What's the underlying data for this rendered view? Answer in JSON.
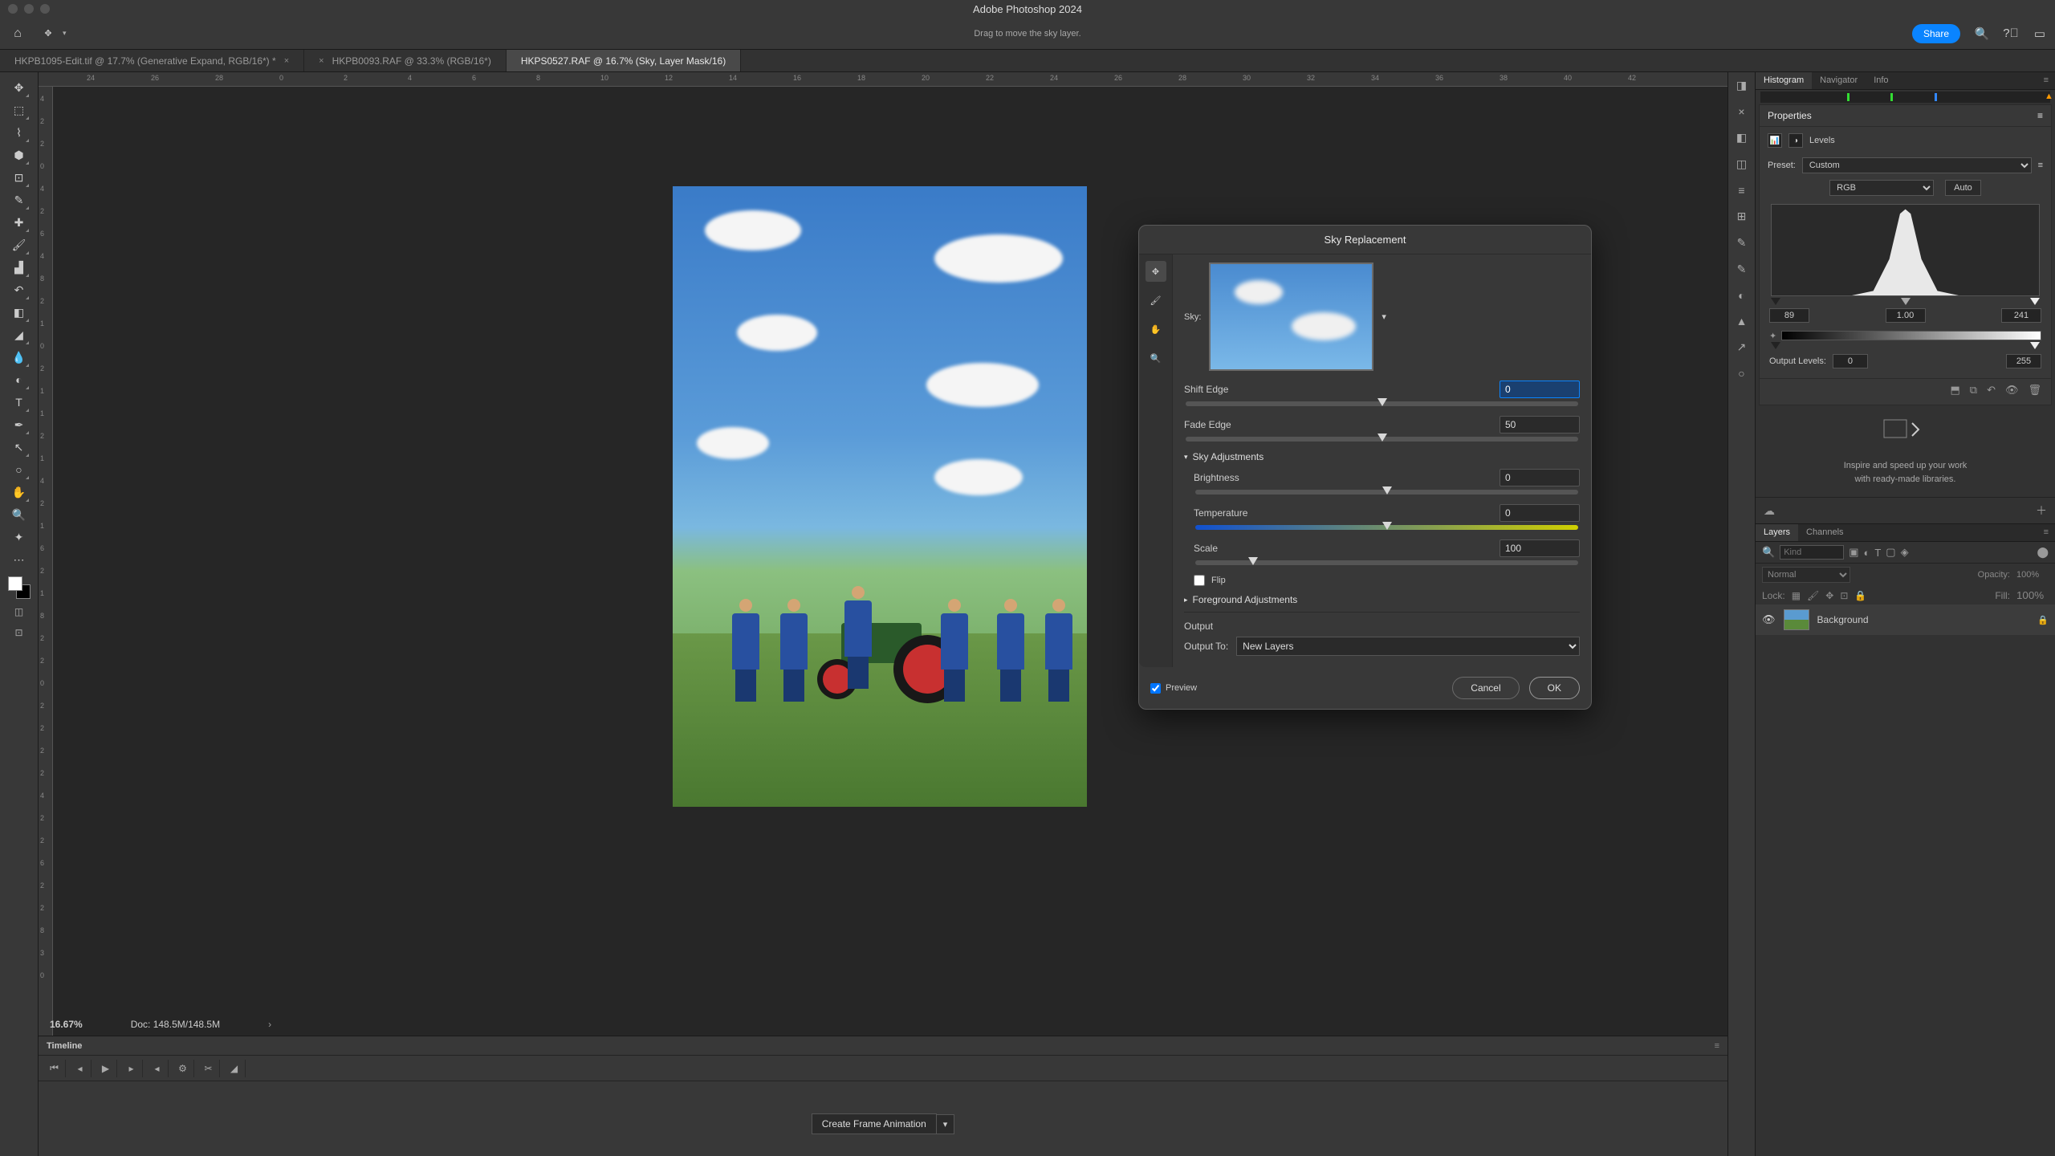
{
  "app_title": "Adobe Photoshop 2024",
  "tooltip": "Drag to move the sky layer.",
  "share_label": "Share",
  "tabs": [
    {
      "label": "HKPB1095-Edit.tif @ 17.7% (Generative Expand, RGB/16*) *"
    },
    {
      "label": "HKPB0093.RAF @ 33.3% (RGB/16*)"
    },
    {
      "label": "HKPS0527.RAF @ 16.7% (Sky, Layer Mask/16)"
    }
  ],
  "ruler_h": [
    "24",
    "26",
    "28",
    "0",
    "2",
    "4",
    "6",
    "8",
    "10",
    "12",
    "14",
    "16",
    "18",
    "20",
    "22",
    "24",
    "26",
    "28",
    "30",
    "32",
    "34",
    "36",
    "38",
    "40",
    "42"
  ],
  "ruler_v": [
    "4",
    "2",
    "2",
    "0",
    "4",
    "2",
    "6",
    "4",
    "8",
    "2",
    "1",
    "0",
    "2",
    "1",
    "1",
    "2",
    "1",
    "4",
    "2",
    "1",
    "6",
    "2",
    "1",
    "8",
    "2",
    "2",
    "0",
    "2",
    "2",
    "2",
    "2",
    "4",
    "2",
    "2",
    "6",
    "2",
    "2",
    "8",
    "3",
    "0"
  ],
  "zoom": "16.67%",
  "doc_info": "Doc: 148.5M/148.5M",
  "timeline_label": "Timeline",
  "create_frame": "Create Frame Animation",
  "dialog": {
    "title": "Sky Replacement",
    "sky_label": "Sky:",
    "shift_edge_label": "Shift Edge",
    "shift_edge_value": "0",
    "fade_edge_label": "Fade Edge",
    "fade_edge_value": "50",
    "sky_adjustments": "Sky Adjustments",
    "brightness_label": "Brightness",
    "brightness_value": "0",
    "temperature_label": "Temperature",
    "temperature_value": "0",
    "scale_label": "Scale",
    "scale_value": "100",
    "flip_label": "Flip",
    "foreground_adjustments": "Foreground Adjustments",
    "output_label": "Output",
    "output_to_label": "Output To:",
    "output_to_value": "New Layers",
    "preview_label": "Preview",
    "cancel": "Cancel",
    "ok": "OK"
  },
  "panels": {
    "histogram_tab": "Histogram",
    "navigator_tab": "Navigator",
    "info_tab": "Info",
    "properties_tab": "Properties",
    "levels_label": "Levels",
    "preset_label": "Preset:",
    "preset_value": "Custom",
    "channel_value": "RGB",
    "auto_label": "Auto",
    "levels_black": "89",
    "levels_mid": "1.00",
    "levels_white": "241",
    "output_levels_label": "Output Levels:",
    "output_black": "0",
    "output_white": "255",
    "libraries_hint1": "Inspire and speed up your work",
    "libraries_hint2": "with ready-made libraries.",
    "layers_tab": "Layers",
    "channels_tab": "Channels",
    "kind_placeholder": "Kind",
    "blend_mode": "Normal",
    "opacity_label": "Opacity:",
    "opacity_value": "100%",
    "lock_label": "Lock:",
    "fill_label": "Fill:",
    "fill_value": "100%",
    "layer_name": "Background"
  }
}
